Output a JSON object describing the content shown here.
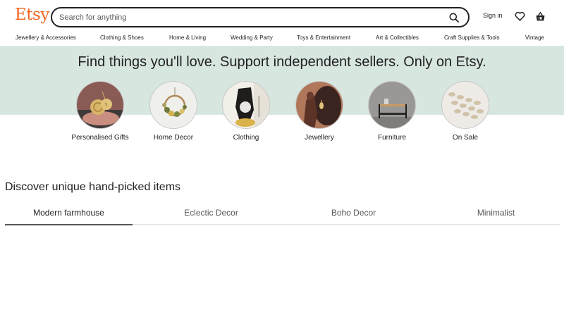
{
  "header": {
    "logo": "Etsy",
    "search_placeholder": "Search for anything",
    "sign_in": "Sign in",
    "brand_color": "#f1641e"
  },
  "categories": [
    "Jewellery & Accessories",
    "Clothing & Shoes",
    "Home & Living",
    "Wedding & Party",
    "Toys & Entertainment",
    "Art & Collectibles",
    "Craft Supplies & Tools",
    "Vintage"
  ],
  "hero": {
    "title": "Find things you'll love. Support independent sellers. Only on Etsy.",
    "background": "#d7e6df",
    "circles": [
      {
        "label": "Personalised Gifts"
      },
      {
        "label": "Home Decor"
      },
      {
        "label": "Clothing"
      },
      {
        "label": "Jewellery"
      },
      {
        "label": "Furniture"
      },
      {
        "label": "On Sale"
      }
    ]
  },
  "discover": {
    "title": "Discover unique hand-picked items",
    "tabs": [
      "Modern farmhouse",
      "Eclectic Decor",
      "Boho Decor",
      "Minimalist"
    ],
    "active_tab": "Modern farmhouse"
  }
}
